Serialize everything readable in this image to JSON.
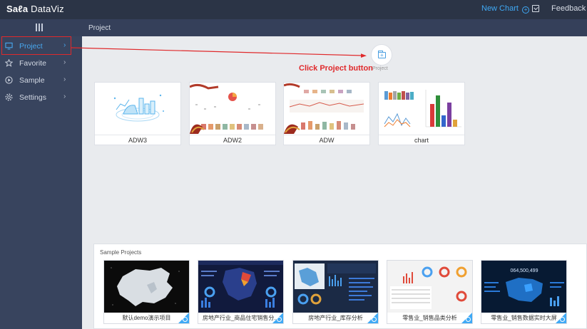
{
  "app": {
    "logo_a": "Sa",
    "logo_b": "ℓa",
    "logo_c": " DataViz"
  },
  "header": {
    "new_chart_label": "New Chart",
    "feedback_label": "Feedback"
  },
  "breadcrumb": "Project",
  "sidebar": {
    "items": [
      {
        "label": "Project",
        "chevron": "›",
        "icon": "monitor-icon"
      },
      {
        "label": "Favorite",
        "chevron": "›",
        "icon": "star-icon"
      },
      {
        "label": "Sample",
        "chevron": "›",
        "icon": "play-icon"
      },
      {
        "label": "Settings",
        "chevron": "›",
        "icon": "gear-icon"
      }
    ]
  },
  "new_project": {
    "label": "Project",
    "icon": "new-folder-icon"
  },
  "annotation": "Click Project button",
  "colors": {
    "accent": "#3fa9f5",
    "highlight": "#e0292b",
    "sidebar": "#38445e",
    "topbar": "#2b3446"
  },
  "projects": [
    {
      "title": "ADW3"
    },
    {
      "title": "ADW2"
    },
    {
      "title": "ADW"
    },
    {
      "title": "chart"
    }
  ],
  "samples": {
    "title": "Sample Projects",
    "items": [
      {
        "title": "默认demo演示项目"
      },
      {
        "title": "房地产行业_商品住宅销售分..."
      },
      {
        "title": "房地产行业_库存分析"
      },
      {
        "title": "零售业_销售品类分析"
      },
      {
        "title": "零售业_销售数据实时大屏"
      }
    ],
    "big_number": "064,500,499"
  }
}
